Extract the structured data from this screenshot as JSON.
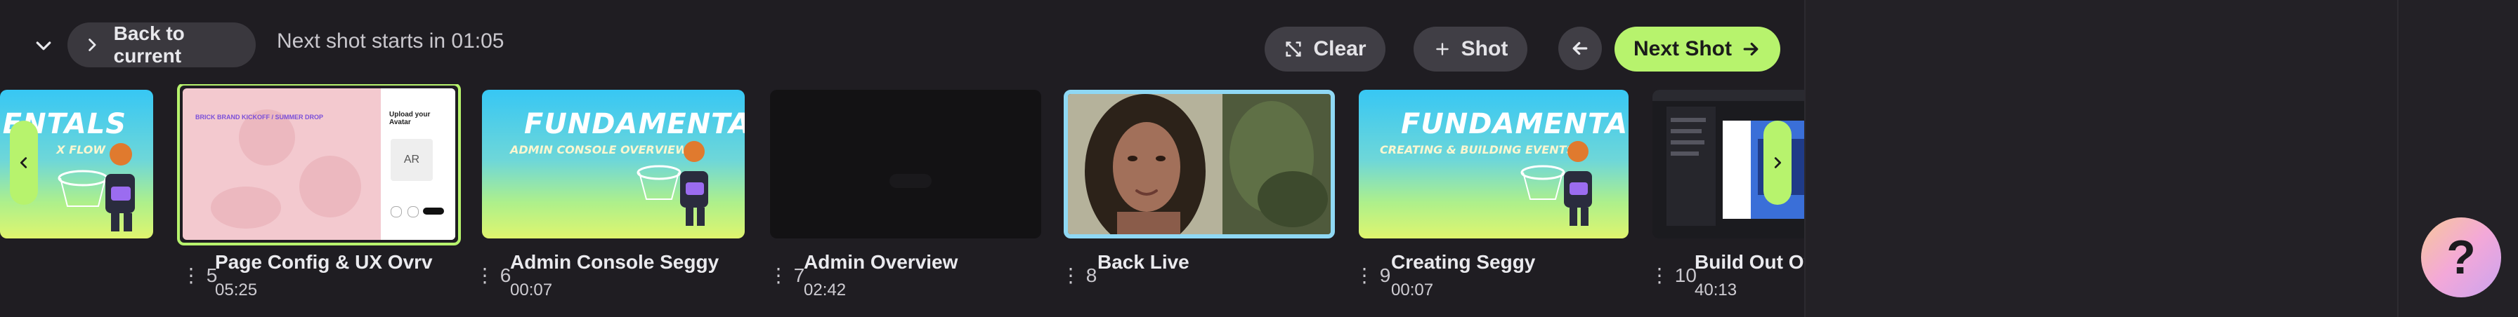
{
  "topbar": {
    "back_to_current_label": "Back to current",
    "next_shot_text": "Next shot starts in 01:05",
    "clear_label": "Clear",
    "shot_label": "Shot",
    "next_shot_label": "Next Shot"
  },
  "shots": [
    {
      "title_partial": "ENTALS",
      "subtitle_partial": "X FLOW"
    },
    {
      "number": "5",
      "title": "Page Config & UX Ovrv",
      "duration": "05:25",
      "selected": true,
      "slide": {
        "heading": "BRICK BRAND KICKOFF / SUMMER DROP",
        "panel_title": "Upload your Avatar",
        "avatar_initials": "AR"
      }
    },
    {
      "number": "6",
      "title": "Admin Console Seggy",
      "duration": "00:07",
      "slide": {
        "title": "FUNDAMENTALS",
        "subtitle": "ADMIN CONSOLE OVERVIEW"
      }
    },
    {
      "number": "7",
      "title": "Admin Overview",
      "duration": "02:42"
    },
    {
      "number": "8",
      "title": "Back Live",
      "duration": "",
      "live": true
    },
    {
      "number": "9",
      "title": "Creating Seggy",
      "duration": "00:07",
      "slide": {
        "title": "FUNDAMENTALS",
        "subtitle": "CREATING & BUILDING EVENTS"
      }
    },
    {
      "number": "10",
      "title": "Build Out Ov",
      "duration": "40:13"
    }
  ],
  "icons": {
    "collapse": "chevron-down-icon",
    "back_to_current": "chevron-right-icon",
    "clear": "clear-icon",
    "shot": "plus-icon",
    "back": "arrow-left-icon",
    "next": "arrow-right-icon",
    "help": "question-icon"
  },
  "help_glyph": "?",
  "colors": {
    "accent": "#b7f36d",
    "background": "#1f1d22",
    "button": "#403e45"
  }
}
